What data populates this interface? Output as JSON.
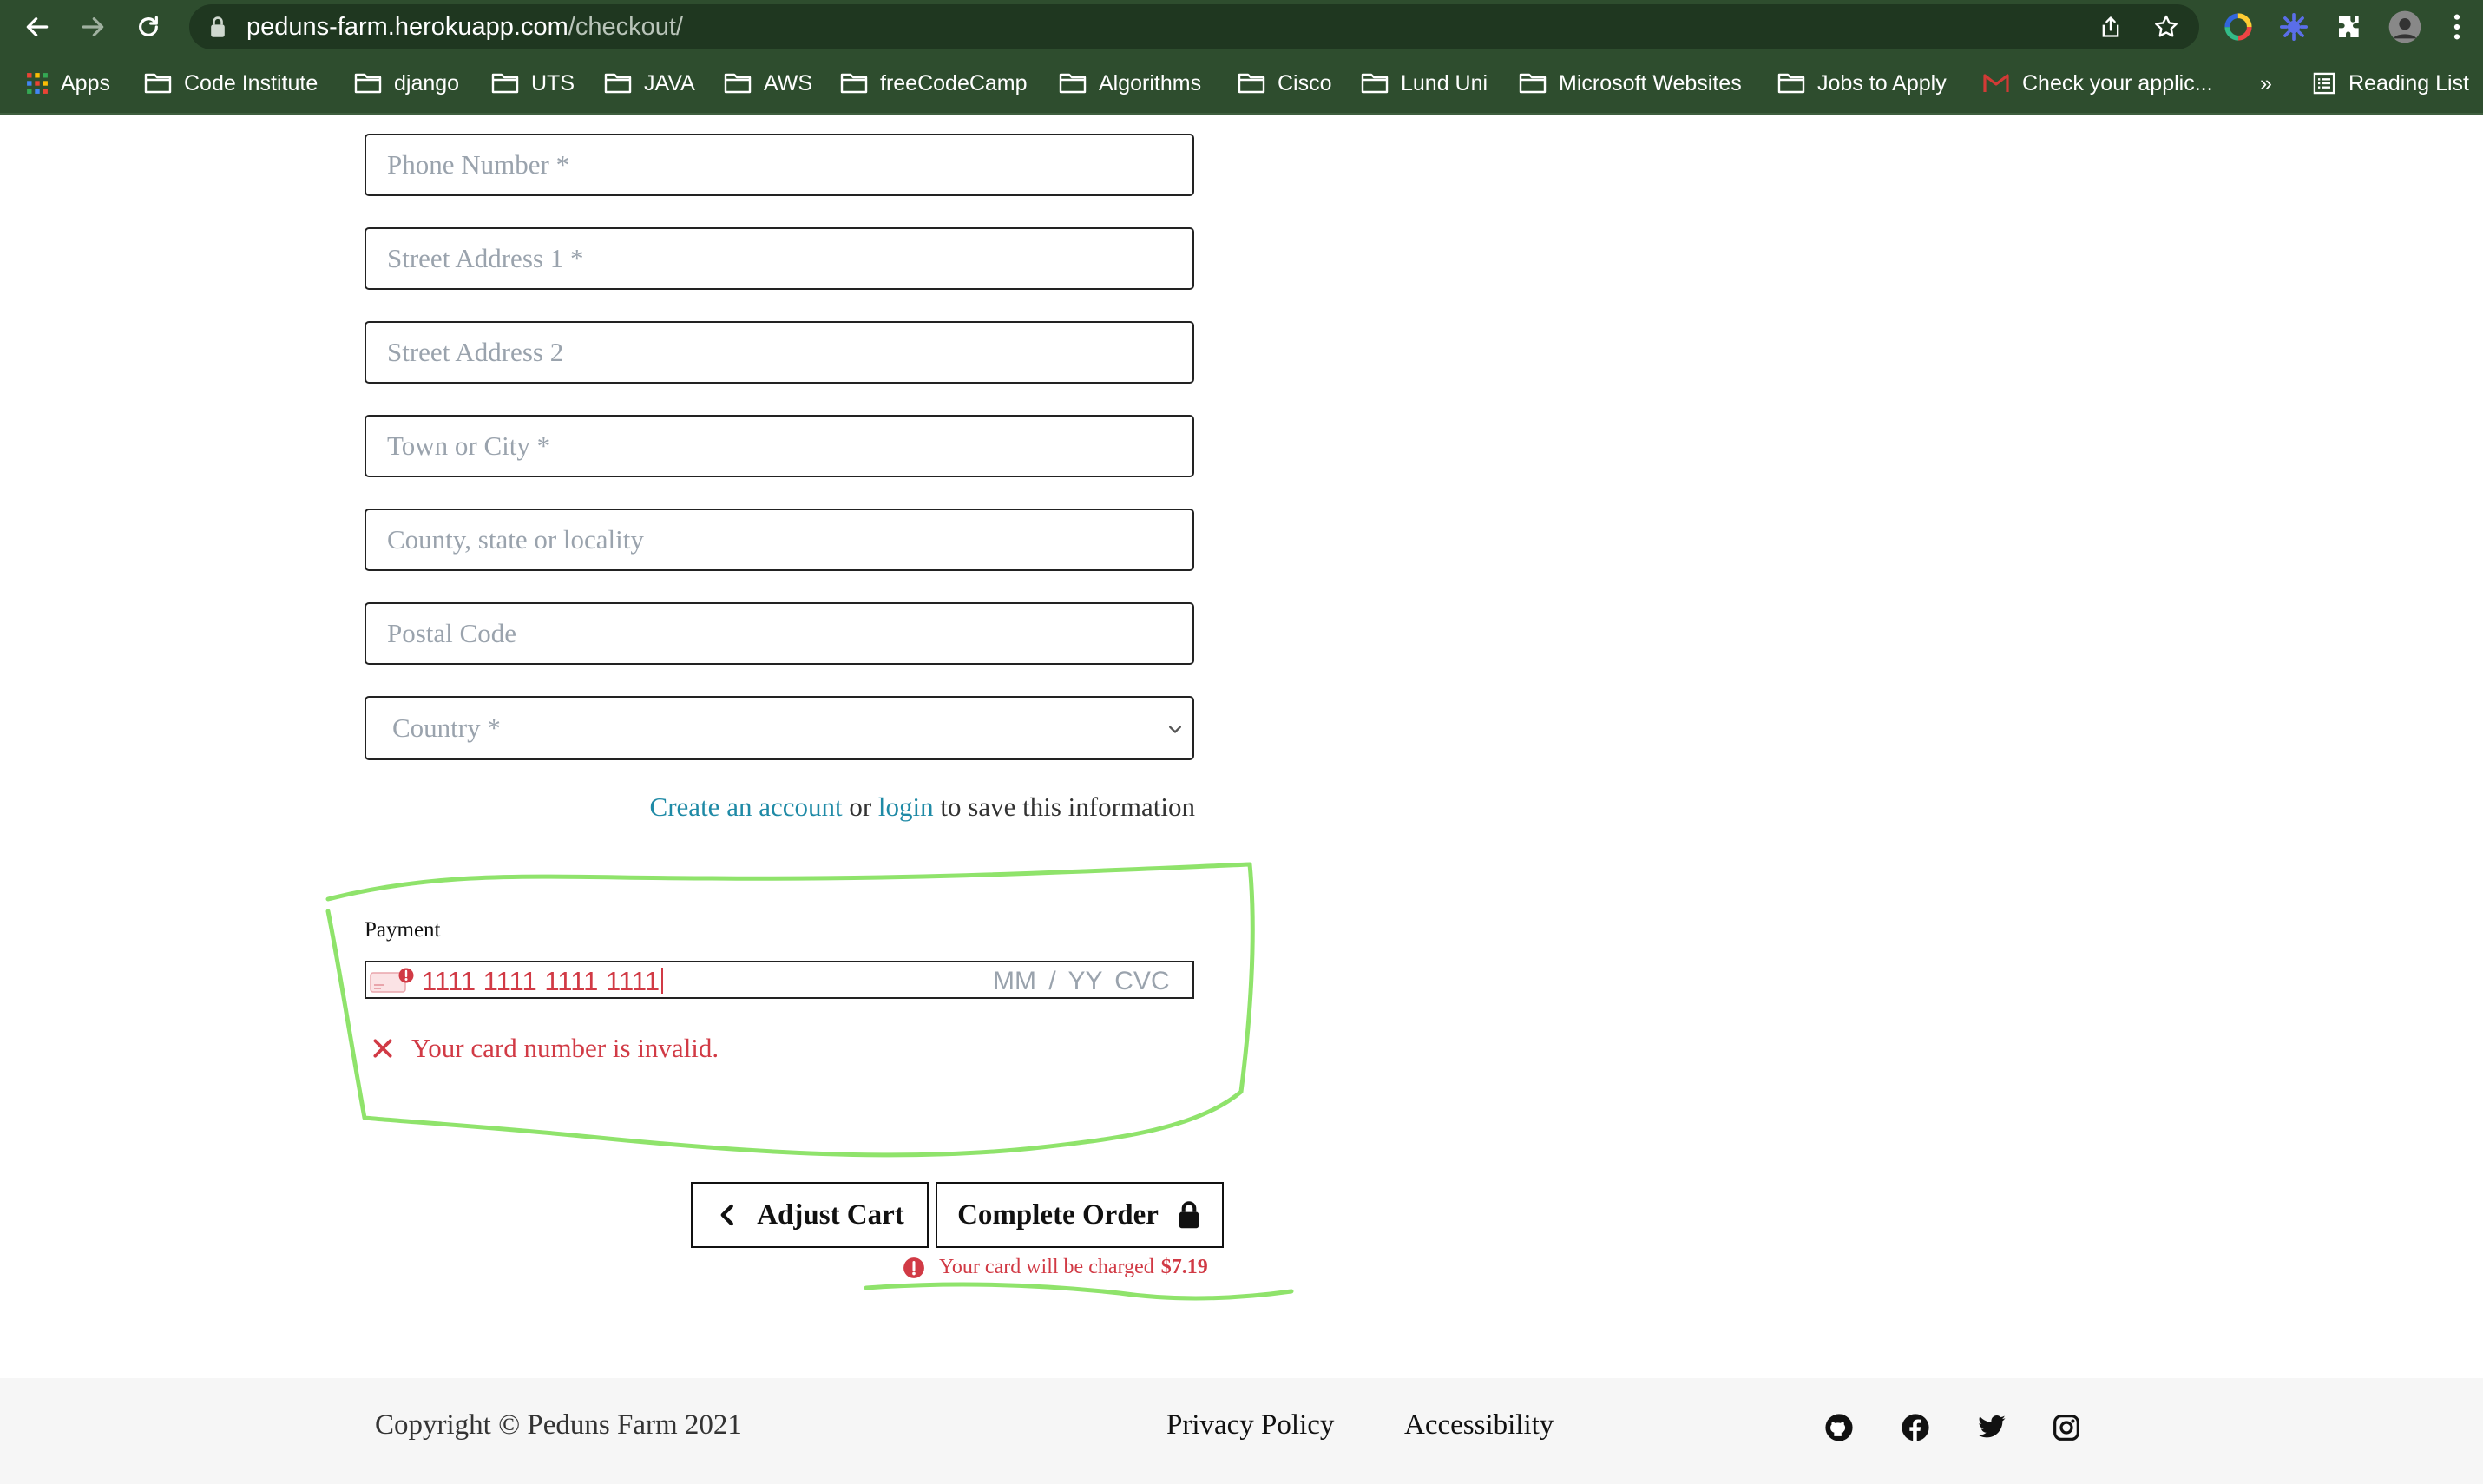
{
  "browser": {
    "url_host": "peduns-farm.herokuapp.com",
    "url_path": "/checkout/",
    "bookmarks": [
      {
        "label": "Apps",
        "icon": "apps-grid-icon"
      },
      {
        "label": "Code Institute",
        "icon": "folder-icon"
      },
      {
        "label": "django",
        "icon": "folder-icon"
      },
      {
        "label": "UTS",
        "icon": "folder-icon"
      },
      {
        "label": "JAVA",
        "icon": "folder-icon"
      },
      {
        "label": "AWS",
        "icon": "folder-icon"
      },
      {
        "label": "freeCodeCamp",
        "icon": "folder-icon"
      },
      {
        "label": "Algorithms",
        "icon": "folder-icon"
      },
      {
        "label": "Cisco",
        "icon": "folder-icon"
      },
      {
        "label": "Lund Uni",
        "icon": "folder-icon"
      },
      {
        "label": "Microsoft Websites",
        "icon": "folder-icon"
      },
      {
        "label": "Jobs to Apply",
        "icon": "folder-icon"
      },
      {
        "label": "Check your applic...",
        "icon": "gmail-icon"
      }
    ],
    "more_label": "»",
    "reading_list": "Reading List"
  },
  "form": {
    "phone_placeholder": "Phone Number *",
    "street1_placeholder": "Street Address 1 *",
    "street2_placeholder": "Street Address 2",
    "town_placeholder": "Town or City *",
    "county_placeholder": "County, state or locality",
    "postcode_placeholder": "Postal Code",
    "country_placeholder": "Country *"
  },
  "save_info": {
    "create_account": "Create an account",
    "or_text": "or",
    "login": "login",
    "suffix": "to save this information"
  },
  "payment": {
    "label": "Payment",
    "card_number": "1111 1111 1111 1111",
    "expiry_placeholder": "MM / YY",
    "cvc_placeholder": "CVC",
    "error_message": "Your card number is invalid."
  },
  "actions": {
    "adjust_cart": "Adjust Cart",
    "complete_order": "Complete Order",
    "charge_text": "Your card will be charged",
    "charge_amount": "$7.19"
  },
  "footer": {
    "copyright": "Copyright © Peduns Farm 2021",
    "privacy": "Privacy Policy",
    "accessibility": "Accessibility",
    "social": [
      "github-icon",
      "facebook-icon",
      "twitter-icon",
      "instagram-icon"
    ]
  },
  "colors": {
    "chrome": "#2e4d2e",
    "error": "#d13a45",
    "link": "#1f8aa6",
    "annotation": "#8fe36b"
  }
}
